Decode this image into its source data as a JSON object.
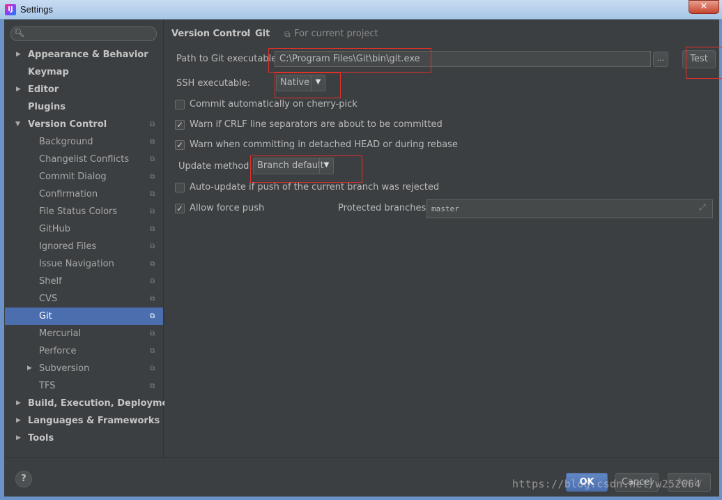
{
  "window": {
    "title": "Settings",
    "close_symbol": "✕"
  },
  "search": {
    "placeholder": ""
  },
  "sidebar": {
    "items": [
      {
        "label": "Appearance & Behavior",
        "expandable": true
      },
      {
        "label": "Keymap"
      },
      {
        "label": "Editor",
        "expandable": true
      },
      {
        "label": "Plugins"
      },
      {
        "label": "Version Control",
        "expanded": true
      },
      {
        "label": "Background"
      },
      {
        "label": "Changelist Conflicts"
      },
      {
        "label": "Commit Dialog"
      },
      {
        "label": "Confirmation"
      },
      {
        "label": "File Status Colors"
      },
      {
        "label": "GitHub"
      },
      {
        "label": "Ignored Files"
      },
      {
        "label": "Issue Navigation"
      },
      {
        "label": "Shelf"
      },
      {
        "label": "CVS"
      },
      {
        "label": "Git",
        "selected": true
      },
      {
        "label": "Mercurial"
      },
      {
        "label": "Perforce"
      },
      {
        "label": "Subversion",
        "expandable": true
      },
      {
        "label": "TFS"
      },
      {
        "label": "Build, Execution, Deployment",
        "expandable": true
      },
      {
        "label": "Languages & Frameworks",
        "expandable": true
      },
      {
        "label": "Tools",
        "expandable": true
      }
    ]
  },
  "breadcrumb": {
    "parent": "Version Control",
    "separator": "›",
    "current": "Git",
    "scope": "For current project"
  },
  "git": {
    "path_label": "Path to Git executable:",
    "path_value": "C:\\Program Files\\Git\\bin\\git.exe",
    "browse_label": "...",
    "test_label": "Test",
    "ssh_label": "SSH executable:",
    "ssh_value": "Native",
    "cherry_pick_label": "Commit automatically on cherry-pick",
    "cherry_pick_checked": false,
    "crlf_label": "Warn if CRLF line separators are about to be committed",
    "crlf_checked": true,
    "detached_label": "Warn when committing in detached HEAD or during rebase",
    "detached_checked": true,
    "update_method_label": "Update method:",
    "update_method_value": "Branch default",
    "auto_update_label": "Auto-update if push of the current branch was rejected",
    "auto_update_checked": false,
    "force_push_label": "Allow force push",
    "force_push_checked": true,
    "protected_label": "Protected branches:",
    "protected_value": "master"
  },
  "footer": {
    "help": "?",
    "ok": "OK",
    "cancel": "Cancel",
    "apply": "Apply",
    "watermark": "https://blog.csdn.net/w252064"
  },
  "colors": {
    "accent": "#4b6eaf",
    "background": "#3c3f41",
    "highlight_box": "#e0302b"
  }
}
